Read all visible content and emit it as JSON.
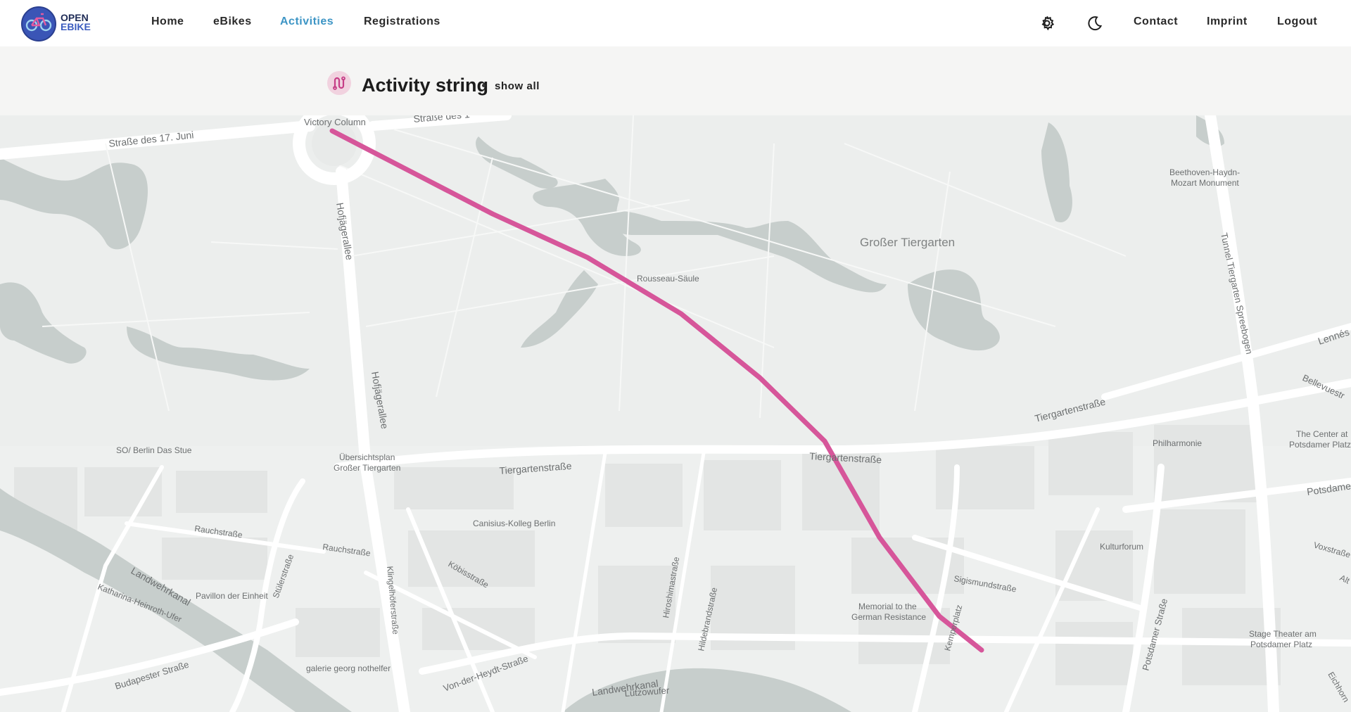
{
  "app": {
    "logo_line1": "OPEN",
    "logo_line2": "EBIKE"
  },
  "nav": {
    "items": [
      {
        "label": "Home",
        "active": false
      },
      {
        "label": "eBikes",
        "active": false
      },
      {
        "label": "Activities",
        "active": true
      },
      {
        "label": "Registrations",
        "active": false
      }
    ],
    "right": [
      {
        "label": "Contact"
      },
      {
        "label": "Imprint"
      },
      {
        "label": "Logout"
      }
    ],
    "icons": [
      "gear-icon",
      "moon-icon"
    ]
  },
  "activity": {
    "title": "Activity string",
    "separator": "·",
    "show_all": "show all",
    "icon": "route-icon",
    "route_color": "#d6569a"
  },
  "map": {
    "labels": {
      "victory_column": "Victory Column",
      "strasse_17_juni": "Straße des 17. Juni",
      "strasse_des_top": "Straße des 1",
      "hofjaegerallee_1": "Hofjägerallee",
      "hofjaegerallee_2": "Hofjägerallee",
      "grosser_tiergarten": "Großer Tiergarten",
      "rousseau": "Rousseau-Säule",
      "beethoven_1": "Beethoven-Haydn-",
      "beethoven_2": "Mozart Monument",
      "tunnel": "Tunnel Tiergarten Spreebogen",
      "lennestr": "Lennés",
      "bellevuestr": "Bellevuestr",
      "tiergartenstr_1": "Tiergartenstraße",
      "tiergartenstr_2": "Tiergartenstraße",
      "tiergartenstr_3": "Tiergartenstraße",
      "center_1": "The Center at",
      "center_2": "Potsdamer Platz",
      "philharmonie": "Philharmonie",
      "potsdamer": "Potsdame",
      "so_berlin": "SO/ Berlin Das Stue",
      "uebersicht_1": "Übersichtsplan",
      "uebersicht_2": "Großer Tiergarten",
      "canisius": "Canisius-Kolleg Berlin",
      "rauchstr_1": "Rauchstraße",
      "rauchstr_2": "Rauchstraße",
      "kulturforum": "Kulturforum",
      "voxstr": "Voxstraße",
      "kobisstr": "Köbisstraße",
      "stuelerstr": "Stülerstraße",
      "landwehrkanal_1": "Landwehrkanal",
      "pavillon": "Pavillon der Einheit",
      "katharina": "Katharina-Heinroth-Ufer",
      "klingelhoefer": "Klingelhöferstraße",
      "hiroshima": "Hiroshimastraße",
      "hildebrand": "Hildebrandstraße",
      "sigismund": "Sigismundstraße",
      "memorial_1": "Memorial to the",
      "memorial_2": "German Resistance",
      "kemper": "Kemperplatz",
      "stage_1": "Stage Theater am",
      "stage_2": "Potsdamer Platz",
      "potsdamer_str": "Potsdamer Straße",
      "budapester": "Budapester Straße",
      "galerie": "galerie georg nothelfer",
      "von_der_heydt": "Von-der-Heydt-Straße",
      "landwehrkanal_2": "Landwehrkanal",
      "luetzowufer": "Lützowufer",
      "eichhorn": "Eichhorn",
      "ah": "Alt"
    }
  }
}
